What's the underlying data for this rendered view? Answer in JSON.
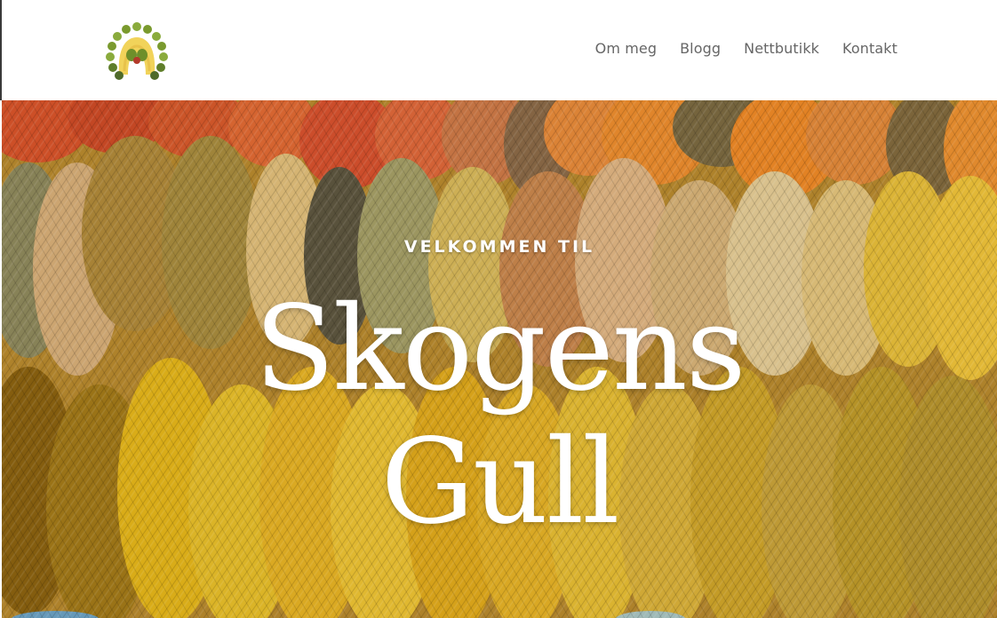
{
  "brand": {
    "logo_icon": "sun-yarn-logo-icon"
  },
  "nav": {
    "items": [
      {
        "label": "Om meg"
      },
      {
        "label": "Blogg"
      },
      {
        "label": "Nettbutikk"
      },
      {
        "label": "Kontakt"
      }
    ]
  },
  "hero": {
    "eyebrow": "VELKOMMEN TIL",
    "title_line1": "Skogens",
    "title_line2": "Gull",
    "background": "yarn-skeins-photo"
  },
  "colors": {
    "nav_text": "#666666",
    "hero_text": "#ffffff",
    "logo_green": "#7a9a2e",
    "logo_dark_green": "#4f6b2a",
    "logo_yellow": "#f1d35a",
    "logo_red": "#b33a2a"
  }
}
